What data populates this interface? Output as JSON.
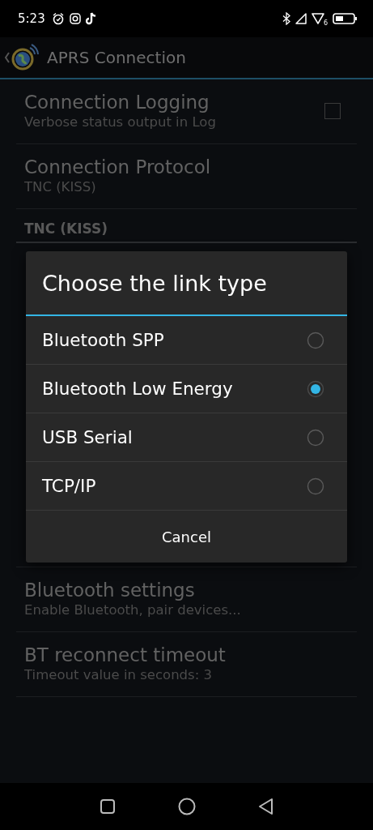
{
  "status_bar": {
    "time": "5:23",
    "wifi_badge": "6"
  },
  "action_bar": {
    "title": "APRS Connection"
  },
  "preferences": [
    {
      "kind": "checkbox",
      "title": "Connection Logging",
      "summary": "Verbose status output in Log",
      "checked": false
    },
    {
      "kind": "plain",
      "title": "Connection Protocol",
      "summary": "TNC (KISS)"
    },
    {
      "kind": "category",
      "title": "TNC (KISS)"
    },
    {
      "kind": "hidden"
    },
    {
      "kind": "plain",
      "title": "Bluetooth settings",
      "summary": "Enable Bluetooth, pair devices..."
    },
    {
      "kind": "plain",
      "title": "BT reconnect timeout",
      "summary": "Timeout value in seconds: 3"
    }
  ],
  "dialog": {
    "title": "Choose the link type",
    "options": [
      {
        "label": "Bluetooth SPP",
        "selected": false
      },
      {
        "label": "Bluetooth Low Energy",
        "selected": true
      },
      {
        "label": "USB Serial",
        "selected": false
      },
      {
        "label": "TCP/IP",
        "selected": false
      }
    ],
    "cancel": "Cancel"
  }
}
